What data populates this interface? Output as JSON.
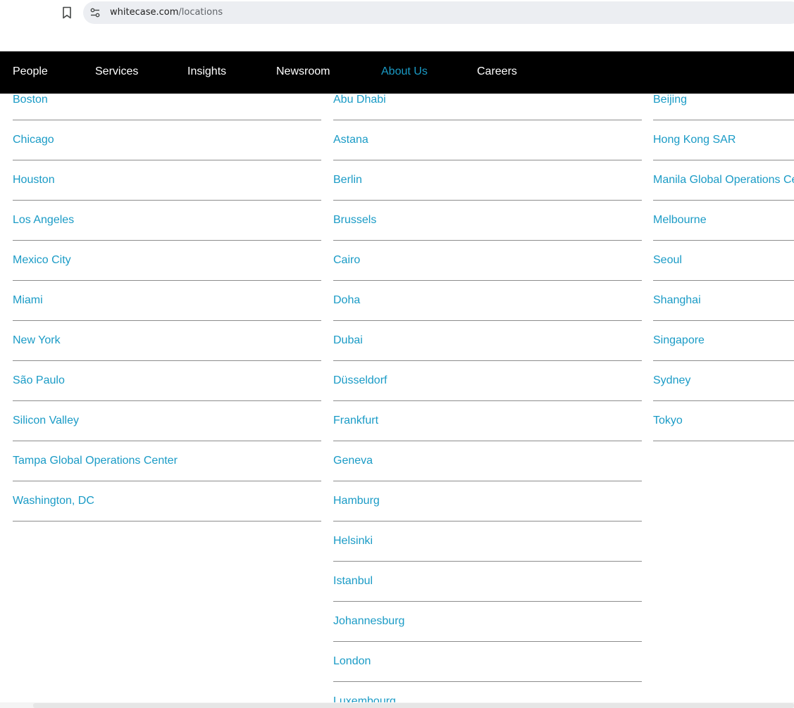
{
  "browser": {
    "url_host": "whitecase.com",
    "url_path": "/locations",
    "icons": {
      "bookmark": "bookmark-icon",
      "site_info": "tune-icon"
    }
  },
  "nav": {
    "items": [
      {
        "label": "People",
        "active": false
      },
      {
        "label": "Services",
        "active": false
      },
      {
        "label": "Insights",
        "active": false
      },
      {
        "label": "Newsroom",
        "active": false
      },
      {
        "label": "About Us",
        "active": true
      },
      {
        "label": "Careers",
        "active": false
      }
    ],
    "active_color": "#1a9bc6",
    "text_color": "#ffffff",
    "background": "#000000"
  },
  "locations": {
    "link_color": "#1a9bc6",
    "columns": [
      {
        "items": [
          "Boston",
          "Chicago",
          "Houston",
          "Los Angeles",
          "Mexico City",
          "Miami",
          "New York",
          "São Paulo",
          "Silicon Valley",
          "Tampa Global Operations Center",
          "Washington, DC"
        ]
      },
      {
        "items": [
          "Abu Dhabi",
          "Astana",
          "Berlin",
          "Brussels",
          "Cairo",
          "Doha",
          "Dubai",
          "Düsseldorf",
          "Frankfurt",
          "Geneva",
          "Hamburg",
          "Helsinki",
          "Istanbul",
          "Johannesburg",
          "London",
          "Luxembourg"
        ]
      },
      {
        "items": [
          "Beijing",
          "Hong Kong SAR",
          "Manila Global Operations Center",
          "Melbourne",
          "Seoul",
          "Shanghai",
          "Singapore",
          "Sydney",
          "Tokyo"
        ]
      }
    ]
  }
}
